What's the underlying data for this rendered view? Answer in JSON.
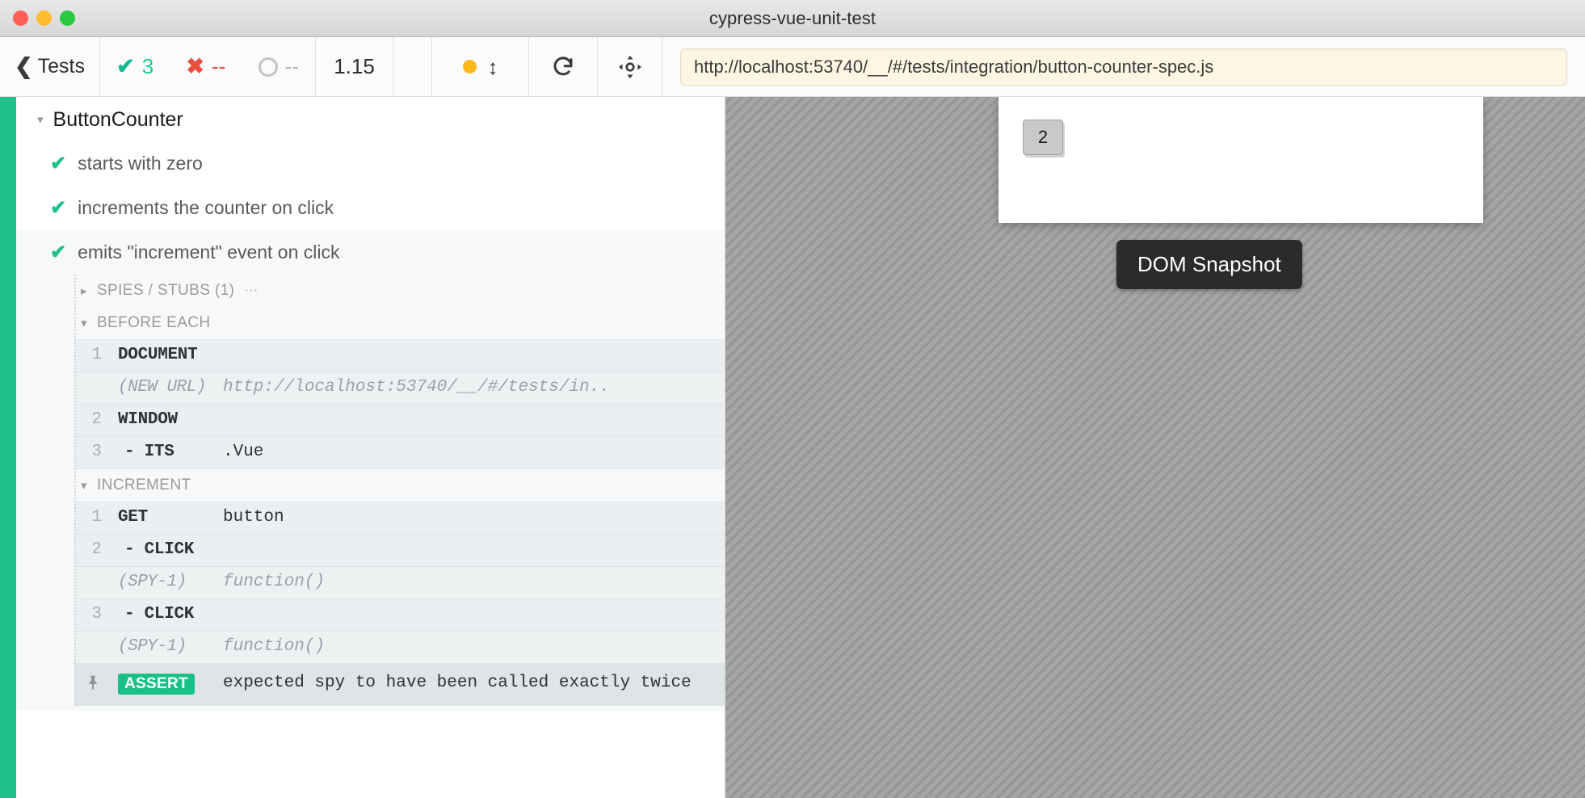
{
  "window": {
    "title": "cypress-vue-unit-test",
    "traffic_lights": [
      "close",
      "minimize",
      "maximize"
    ]
  },
  "toolbar": {
    "back_label": "Tests",
    "back_icon": "chevron-left-icon",
    "stats": {
      "passed": {
        "icon": "check-icon",
        "value": "3"
      },
      "failed": {
        "icon": "x-icon",
        "value": "--"
      },
      "pending": {
        "icon": "circle-icon",
        "value": "--"
      }
    },
    "duration": "1.15",
    "viewport_icon": "viewport-size-icon",
    "viewport_arrow": "↕",
    "reload_icon": "reload-icon",
    "selector_playground_icon": "crosshair-target-icon",
    "url": "http://localhost:53740/__/#/tests/integration/button-counter-spec.js"
  },
  "reporter": {
    "suite": {
      "caret": "▾",
      "title": "ButtonCounter"
    },
    "tests": [
      {
        "state_icon": "✔",
        "title": "starts with zero",
        "active": false
      },
      {
        "state_icon": "✔",
        "title": "increments the counter on click",
        "active": false
      },
      {
        "state_icon": "✔",
        "title": "emits \"increment\" event on click",
        "active": true
      }
    ],
    "spies_stubs": {
      "caret": "▸",
      "label": "SPIES / STUBS (1)",
      "dots": "⋯"
    },
    "hooks": [
      {
        "caret": "▾",
        "label": "BEFORE EACH",
        "commands": [
          {
            "num": "1",
            "name": "DOCUMENT",
            "message": "",
            "child": false,
            "meta": false
          },
          {
            "num": "",
            "name": "(NEW URL)",
            "message": "http://localhost:53740/__/#/tests/in..",
            "child": false,
            "meta": true
          },
          {
            "num": "2",
            "name": "WINDOW",
            "message": "",
            "child": false,
            "meta": false
          },
          {
            "num": "3",
            "name": "- ITS",
            "message": ".Vue",
            "child": true,
            "meta": false
          }
        ]
      },
      {
        "caret": "▾",
        "label": "INCREMENT",
        "commands": [
          {
            "num": "1",
            "name": "GET",
            "message": "button",
            "child": false,
            "meta": false
          },
          {
            "num": "2",
            "name": "- CLICK",
            "message": "",
            "child": true,
            "meta": false
          },
          {
            "num": "",
            "name": "(SPY-1)",
            "message": "function()",
            "child": false,
            "meta": true
          },
          {
            "num": "3",
            "name": "- CLICK",
            "message": "",
            "child": true,
            "meta": false
          },
          {
            "num": "",
            "name": "(SPY-1)",
            "message": "function()",
            "child": false,
            "meta": true
          }
        ]
      }
    ],
    "assertion": {
      "pin_icon": "📌",
      "badge": "ASSERT",
      "message": "expected spy to have been called exactly twice"
    }
  },
  "preview": {
    "counter_button_label": "2",
    "snapshot_badge": "DOM Snapshot"
  },
  "colors": {
    "pass_green": "#1fc08a",
    "fail_red": "#e8503a",
    "assert_green": "#17c088",
    "viewport_orange": "#ffb81c",
    "url_bg": "#fdf6e3"
  }
}
